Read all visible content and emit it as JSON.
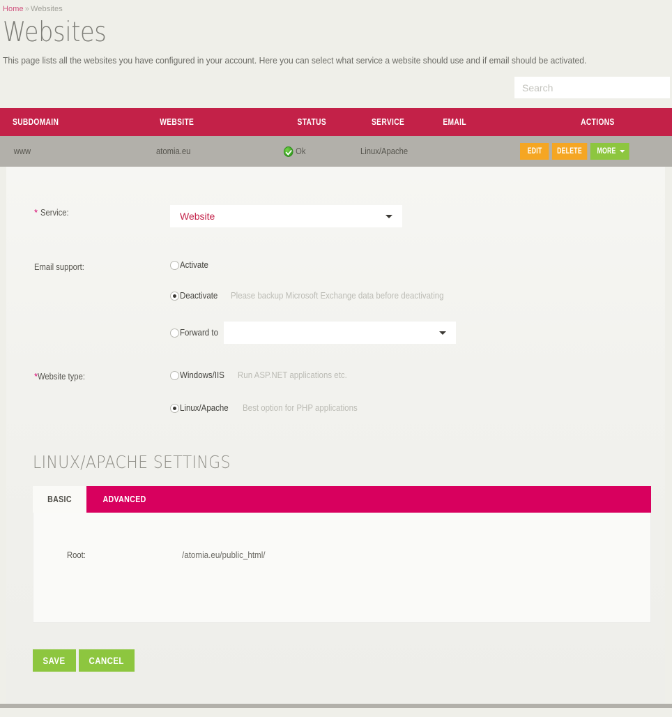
{
  "breadcrumb": {
    "home": "Home",
    "separator": "»",
    "current": "Websites"
  },
  "page": {
    "title": "Websites",
    "intro": "This page lists all the websites you have configured in your account. Here you can select what service a website should use and if email should be activated."
  },
  "search": {
    "placeholder": "Search",
    "value": ""
  },
  "table": {
    "headers": {
      "subdomain": "SUBDOMAIN",
      "website": "WEBSITE",
      "status": "STATUS",
      "service": "SERVICE",
      "email": "EMAIL",
      "actions": "ACTIONS"
    },
    "rows": [
      {
        "subdomain": "www",
        "website": "atomia.eu",
        "status": "Ok",
        "status_icon": "green-check-icon",
        "service": "Linux/Apache",
        "email": "",
        "actions": {
          "edit": "EDIT",
          "delete": "DELETE",
          "more": "MORE"
        }
      }
    ]
  },
  "form": {
    "service": {
      "label": "Service:",
      "required_mark": "*",
      "selected": "Website"
    },
    "email_support": {
      "label": "Email support:",
      "options": [
        {
          "label": "Activate",
          "checked": false,
          "hint": ""
        },
        {
          "label": "Deactivate",
          "checked": true,
          "hint": "Please backup Microsoft Exchange data before deactivating"
        },
        {
          "label": "Forward to",
          "checked": false,
          "hint": ""
        }
      ],
      "forward_to_value": ""
    },
    "website_type": {
      "label": "Website type:",
      "required_mark": "*",
      "options": [
        {
          "label": "Windows/IIS",
          "checked": false,
          "hint": "Run ASP.NET applications etc."
        },
        {
          "label": "Linux/Apache",
          "checked": true,
          "hint": "Best option for PHP applications"
        }
      ]
    }
  },
  "settings": {
    "section_title": "LINUX/APACHE SETTINGS",
    "tabs": [
      {
        "label": "BASIC",
        "active": true
      },
      {
        "label": "ADVANCED",
        "active": false
      }
    ],
    "basic": {
      "root_label": "Root:",
      "root_value": "/atomia.eu/public_html/"
    }
  },
  "footer": {
    "save": "SAVE",
    "cancel": "CANCEL"
  },
  "colors": {
    "table_header": "#c32148",
    "tab_bar": "#d8005e",
    "accent_pink": "#d6006e",
    "green_button": "#8dc63f",
    "orange_button": "#f5a623",
    "page_bg": "#efefe9",
    "row_gray": "#b2b0aa"
  }
}
